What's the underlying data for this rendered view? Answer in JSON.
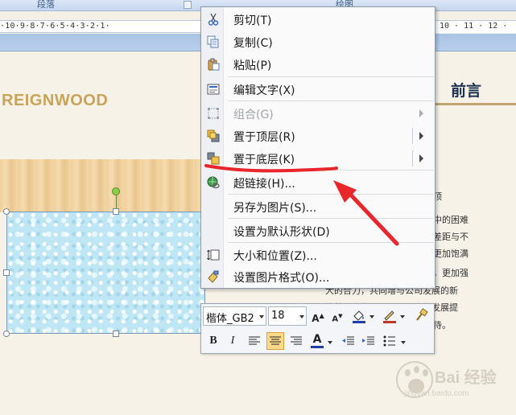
{
  "ribbon": {
    "group_paragraph": "段落",
    "group_drawing": "绘图"
  },
  "ruler": {
    "left_text": "·10·9·8·7·6·5·4·3·2·1·",
    "right_text": "10 · 11 · 12 ·"
  },
  "document": {
    "logo_text": "REIGNWOOD",
    "preface_title": "前言",
    "body_fragments": [
      "顶",
      "中的困难",
      "差距与不",
      "更加饱满",
      "，更加强",
      "大的合力，共同增与公司发展的新",
      "旅蒂，为集团公司以及企业发展提",
      "侍。"
    ]
  },
  "context_menu": {
    "items": [
      {
        "label": "剪切(T)",
        "icon": "scissors-icon"
      },
      {
        "label": "复制(C)",
        "icon": "copy-icon"
      },
      {
        "label": "粘贴(P)",
        "icon": "paste-icon"
      },
      {
        "label": "编辑文字(X)",
        "icon": "edit-text-icon"
      },
      {
        "label": "组合(G)",
        "icon": "group-icon",
        "disabled": true,
        "submenu": true
      },
      {
        "label": "置于顶层(R)",
        "icon": "bring-to-front-icon",
        "submenu": true
      },
      {
        "label": "置于底层(K)",
        "icon": "send-to-back-icon",
        "submenu": true
      },
      {
        "label": "超链接(H)...",
        "icon": "hyperlink-icon"
      },
      {
        "label": "另存为图片(S)...",
        "icon": ""
      },
      {
        "label": "设置为默认形状(D)",
        "icon": ""
      },
      {
        "label": "大小和位置(Z)...",
        "icon": "size-position-icon"
      },
      {
        "label": "设置图片格式(O)...",
        "icon": "format-picture-icon"
      }
    ]
  },
  "mini_toolbar": {
    "font_name": "楷体_GB2",
    "font_size": "18",
    "bold": "B",
    "italic": "I",
    "grow_font": "A",
    "shrink_font": "A",
    "font_color": "A"
  },
  "watermark": {
    "text": "Bai 经验",
    "url": "jingyan.baidu.com"
  },
  "colors": {
    "annotation_red": "#e8262b",
    "logo_gold": "#c8a45a",
    "preface_navy": "#1c3050",
    "highlight": "#fbd98a"
  }
}
